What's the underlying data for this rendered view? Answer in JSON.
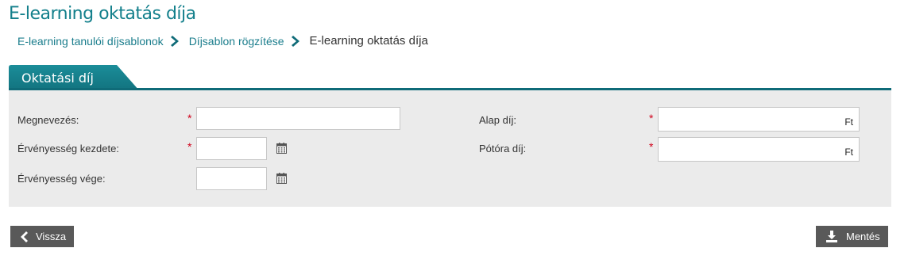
{
  "page": {
    "title": "E-learning oktatás díja"
  },
  "breadcrumb": {
    "items": [
      "E-learning tanulói díjsablonok",
      "Díjsablon rögzítése"
    ],
    "current": "E-learning oktatás díja"
  },
  "section": {
    "tab_label": "Oktatási díj"
  },
  "form": {
    "name": {
      "label": "Megnevezés:",
      "value": ""
    },
    "valid_from": {
      "label": "Érvényesség kezdete:",
      "value": ""
    },
    "valid_to": {
      "label": "Érvényesség vége:",
      "value": ""
    },
    "base_fee": {
      "label": "Alap díj:",
      "value": "",
      "suffix": "Ft"
    },
    "extra_fee": {
      "label": "Pótóra díj:",
      "value": "",
      "suffix": "Ft"
    },
    "required_marker": "*"
  },
  "actions": {
    "back_label": "Vissza",
    "save_label": "Mentés"
  },
  "icons": {
    "breadcrumb_separator": "chevron-right-icon",
    "calendar": "calendar-icon",
    "back": "chevron-left-icon",
    "save": "download-icon"
  },
  "colors": {
    "accent": "#14808c",
    "tab_dark": "#0f6b78",
    "panel_bg": "#ebebeb",
    "button_bg": "#595959",
    "required": "#d0021b"
  }
}
